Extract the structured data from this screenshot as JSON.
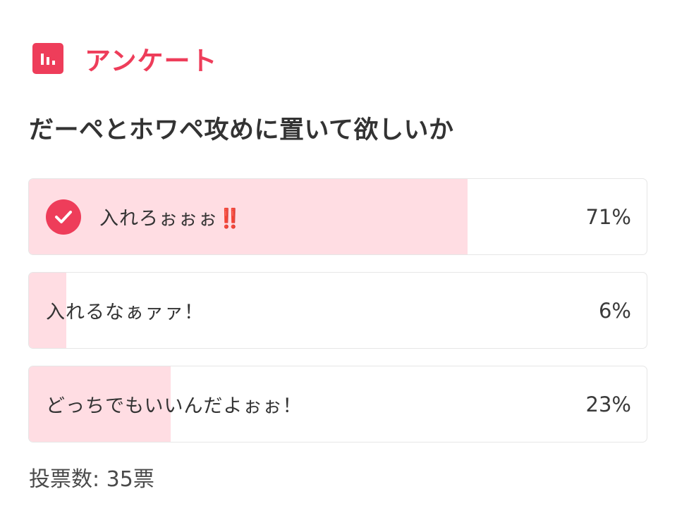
{
  "header": {
    "icon": "bar-chart-icon",
    "title": "アンケート",
    "accent_color": "#ee3d5a"
  },
  "poll": {
    "question": "だーペとホワペ攻めに置いて欲しいか",
    "options": [
      {
        "label": "入れろぉぉぉ‼️",
        "percent": "71%",
        "share": 0.71,
        "selected": true
      },
      {
        "label": "入れるなぁァァ！",
        "percent": "6%",
        "share": 0.06,
        "selected": false
      },
      {
        "label": "どっちでもいいんだよぉぉ！",
        "percent": "23%",
        "share": 0.23,
        "selected": false
      }
    ],
    "fill_color": "#ffdde3",
    "vote_count": "投票数: 35票"
  }
}
